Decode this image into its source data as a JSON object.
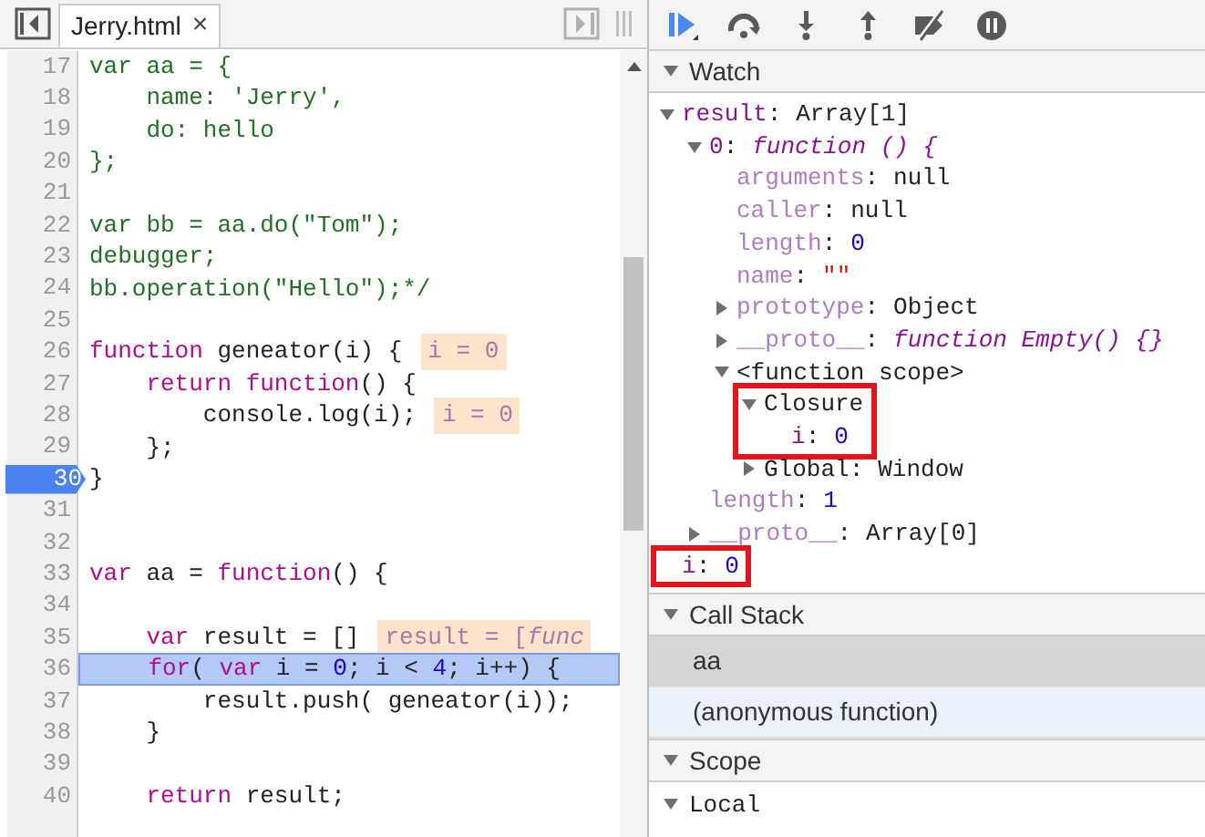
{
  "editor": {
    "tab": {
      "label": "Jerry.html",
      "selected": true,
      "close": "×"
    },
    "lines": [
      {
        "number": "17",
        "breakpoint": false,
        "current": false,
        "tokens": [
          {
            "kind": "comment",
            "text": "var aa = {"
          }
        ]
      },
      {
        "number": "18",
        "breakpoint": false,
        "current": false,
        "tokens": [
          {
            "kind": "comment",
            "text": "    name: 'Jerry',"
          }
        ]
      },
      {
        "number": "19",
        "breakpoint": false,
        "current": false,
        "tokens": [
          {
            "kind": "comment",
            "text": "    do: hello"
          }
        ]
      },
      {
        "number": "20",
        "breakpoint": false,
        "current": false,
        "tokens": [
          {
            "kind": "comment",
            "text": "};"
          }
        ]
      },
      {
        "number": "21",
        "breakpoint": false,
        "current": false
      },
      {
        "number": "22",
        "breakpoint": false,
        "current": false,
        "tokens": [
          {
            "kind": "comment",
            "text": "var bb = aa.do(\"Tom\");"
          }
        ]
      },
      {
        "number": "23",
        "breakpoint": false,
        "current": false,
        "tokens": [
          {
            "kind": "comment",
            "text": "debugger;"
          }
        ]
      },
      {
        "number": "24",
        "breakpoint": false,
        "current": false,
        "tokens": [
          {
            "kind": "comment",
            "text": "bb.operation(\"Hello\");*/"
          }
        ]
      },
      {
        "number": "25",
        "breakpoint": false,
        "current": false
      },
      {
        "number": "26",
        "breakpoint": false,
        "current": false,
        "tokens": [
          {
            "kind": "keyword",
            "text": "function"
          },
          {
            "kind": "plain",
            "text": " geneator(i) {"
          }
        ],
        "inline_value": "i = 0"
      },
      {
        "number": "27",
        "breakpoint": false,
        "current": false,
        "tokens": [
          {
            "kind": "keyword",
            "text": "    return"
          },
          {
            "kind": "keyword",
            "text": " function"
          },
          {
            "kind": "plain",
            "text": "() {"
          }
        ]
      },
      {
        "number": "28",
        "breakpoint": false,
        "current": false,
        "tokens": [
          {
            "kind": "plain",
            "text": "        console.log(i);"
          }
        ],
        "inline_value": "i = 0"
      },
      {
        "number": "29",
        "breakpoint": false,
        "current": false,
        "tokens": [
          {
            "kind": "plain",
            "text": "    };"
          }
        ]
      },
      {
        "number": "30",
        "breakpoint": true,
        "current": false,
        "tokens": [
          {
            "kind": "plain",
            "text": "}"
          }
        ]
      },
      {
        "number": "31",
        "breakpoint": false,
        "current": false
      },
      {
        "number": "32",
        "breakpoint": false,
        "current": false
      },
      {
        "number": "33",
        "breakpoint": false,
        "current": false,
        "tokens": [
          {
            "kind": "keyword",
            "text": "var"
          },
          {
            "kind": "plain",
            "text": " aa = "
          },
          {
            "kind": "keyword",
            "text": "function"
          },
          {
            "kind": "plain",
            "text": "() {"
          }
        ]
      },
      {
        "number": "34",
        "breakpoint": false,
        "current": false
      },
      {
        "number": "35",
        "breakpoint": false,
        "current": false,
        "tokens": [
          {
            "kind": "keyword",
            "text": "    var"
          },
          {
            "kind": "plain",
            "text": " result = []"
          }
        ],
        "inline_value": "result = [*func*"
      },
      {
        "number": "36",
        "breakpoint": false,
        "current": true,
        "tokens": [
          {
            "kind": "keyword",
            "text": "    for"
          },
          {
            "kind": "plain",
            "text": "( "
          },
          {
            "kind": "keyword",
            "text": "var"
          },
          {
            "kind": "plain",
            "text": " i = "
          },
          {
            "kind": "number",
            "text": "0"
          },
          {
            "kind": "plain",
            "text": "; i < "
          },
          {
            "kind": "number",
            "text": "4"
          },
          {
            "kind": "plain",
            "text": "; i++) {"
          }
        ]
      },
      {
        "number": "37",
        "breakpoint": false,
        "current": false,
        "tokens": [
          {
            "kind": "plain",
            "text": "        result.push( geneator(i));"
          }
        ]
      },
      {
        "number": "38",
        "breakpoint": false,
        "current": false,
        "tokens": [
          {
            "kind": "plain",
            "text": "    }"
          }
        ]
      },
      {
        "number": "39",
        "breakpoint": false,
        "current": false
      },
      {
        "number": "40",
        "breakpoint": false,
        "current": false,
        "tokens": [
          {
            "kind": "keyword",
            "text": "    return"
          },
          {
            "kind": "plain",
            "text": " result;"
          }
        ]
      }
    ]
  },
  "debugger": {
    "toolbar": [
      {
        "kind": "resume",
        "active": true
      },
      {
        "kind": "step_over",
        "active": false
      },
      {
        "kind": "step_into",
        "active": false
      },
      {
        "kind": "step_out",
        "active": false
      },
      {
        "kind": "deactivate",
        "active": false
      },
      {
        "kind": "pause_exceptions",
        "active": false
      }
    ],
    "watch": {
      "title": "Watch",
      "expanded": true,
      "nodes": [
        {
          "kind": "property",
          "key": "result",
          "separator": ":",
          "value": {
            "kind": "plain",
            "text": "Array[1]"
          },
          "expanded": true,
          "highlighted": false,
          "children": [
            {
              "kind": "property",
              "key": "0",
              "separator": ":",
              "value": {
                "kind": "func",
                "text": "function () {"
              },
              "expanded": true,
              "highlighted": false,
              "children": [
                {
                  "kind": "internal",
                  "key": "arguments",
                  "separator": ":",
                  "value": {
                    "kind": "plain",
                    "text": "null"
                  },
                  "highlighted": false
                },
                {
                  "kind": "internal",
                  "key": "caller",
                  "separator": ":",
                  "value": {
                    "kind": "plain",
                    "text": "null"
                  },
                  "highlighted": false
                },
                {
                  "kind": "internal",
                  "key": "length",
                  "separator": ":",
                  "value": {
                    "kind": "number",
                    "text": "0"
                  },
                  "highlighted": false
                },
                {
                  "kind": "internal",
                  "key": "name",
                  "separator": ":",
                  "value": {
                    "kind": "string",
                    "text": "\"\""
                  },
                  "highlighted": false
                },
                {
                  "kind": "internal",
                  "key": "prototype",
                  "separator": ":",
                  "value": {
                    "kind": "plain",
                    "text": "Object"
                  },
                  "expanded": false,
                  "highlighted": false
                },
                {
                  "kind": "internal",
                  "key": "__proto__",
                  "separator": ":",
                  "value": {
                    "kind": "func",
                    "text": "function Empty() {}"
                  },
                  "expanded": false,
                  "highlighted": false
                },
                {
                  "kind": "scope",
                  "key": "<function scope>",
                  "expanded": true,
                  "highlighted": false,
                  "children": [
                    {
                      "kind": "scope",
                      "key": "Closure",
                      "expanded": true,
                      "highlighted": true,
                      "children": [
                        {
                          "kind": "property",
                          "key": "i",
                          "separator": ":",
                          "value": {
                            "kind": "number",
                            "text": "0"
                          },
                          "highlighted": false
                        }
                      ]
                    },
                    {
                      "kind": "scope",
                      "key": "Global",
                      "separator": ":",
                      "value": {
                        "kind": "plain",
                        "text": "Window"
                      },
                      "expanded": false,
                      "highlighted": false
                    }
                  ]
                }
              ]
            },
            {
              "kind": "internal",
              "key": "length",
              "separator": ":",
              "value": {
                "kind": "number",
                "text": "1"
              },
              "highlighted": false
            },
            {
              "kind": "internal",
              "key": "__proto__",
              "separator": ":",
              "value": {
                "kind": "plain",
                "text": "Array[0]"
              },
              "expanded": false,
              "highlighted": false
            }
          ]
        },
        {
          "kind": "property",
          "key": "i",
          "separator": ":",
          "value": {
            "kind": "number",
            "text": "0"
          },
          "highlighted": true
        }
      ]
    },
    "call_stack": {
      "title": "Call Stack",
      "expanded": true,
      "frames": [
        {
          "label": "aa",
          "selected": true,
          "hovered": false
        },
        {
          "label": "(anonymous function)",
          "selected": false,
          "hovered": true
        }
      ]
    },
    "scope": {
      "title": "Scope",
      "expanded": true,
      "items": [
        {
          "label": "Local",
          "expanded": true
        }
      ]
    }
  }
}
